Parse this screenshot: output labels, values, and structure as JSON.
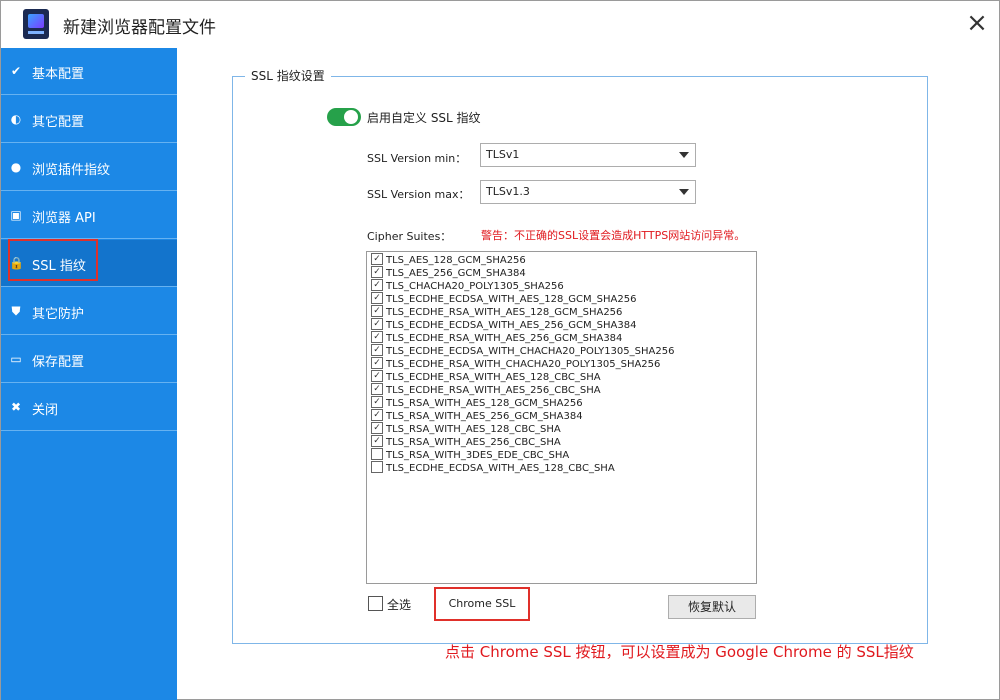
{
  "window": {
    "title": "新建浏览器配置文件",
    "close_icon": "×"
  },
  "sidebar": {
    "items": [
      {
        "label": "基本配置",
        "icon": "✔"
      },
      {
        "label": "其它配置",
        "icon": "◐"
      },
      {
        "label": "浏览插件指纹",
        "icon": "●"
      },
      {
        "label": "浏览器 API",
        "icon": "▣"
      },
      {
        "label": "SSL 指纹",
        "icon": "🔒"
      },
      {
        "label": "其它防护",
        "icon": "⛊"
      },
      {
        "label": "保存配置",
        "icon": "▭"
      },
      {
        "label": "关闭",
        "icon": "✖"
      }
    ],
    "active_index": 4
  },
  "ssl": {
    "group_title": "SSL 指纹设置",
    "toggle_label": "启用自定义 SSL 指纹",
    "toggle_on": true,
    "version_min_label": "SSL Version min：",
    "version_min_value": "TLSv1",
    "version_max_label": "SSL Version max：",
    "version_max_value": "TLSv1.3",
    "cipher_label": "Cipher Suites：",
    "warning": "警告：不正确的SSL设置会造成HTTPS网站访问异常。",
    "ciphers": [
      {
        "name": "TLS_AES_128_GCM_SHA256",
        "checked": true
      },
      {
        "name": "TLS_AES_256_GCM_SHA384",
        "checked": true
      },
      {
        "name": "TLS_CHACHA20_POLY1305_SHA256",
        "checked": true
      },
      {
        "name": "TLS_ECDHE_ECDSA_WITH_AES_128_GCM_SHA256",
        "checked": true
      },
      {
        "name": "TLS_ECDHE_RSA_WITH_AES_128_GCM_SHA256",
        "checked": true
      },
      {
        "name": "TLS_ECDHE_ECDSA_WITH_AES_256_GCM_SHA384",
        "checked": true
      },
      {
        "name": "TLS_ECDHE_RSA_WITH_AES_256_GCM_SHA384",
        "checked": true
      },
      {
        "name": "TLS_ECDHE_ECDSA_WITH_CHACHA20_POLY1305_SHA256",
        "checked": true
      },
      {
        "name": "TLS_ECDHE_RSA_WITH_CHACHA20_POLY1305_SHA256",
        "checked": true
      },
      {
        "name": "TLS_ECDHE_RSA_WITH_AES_128_CBC_SHA",
        "checked": true
      },
      {
        "name": "TLS_ECDHE_RSA_WITH_AES_256_CBC_SHA",
        "checked": true
      },
      {
        "name": "TLS_RSA_WITH_AES_128_GCM_SHA256",
        "checked": true
      },
      {
        "name": "TLS_RSA_WITH_AES_256_GCM_SHA384",
        "checked": true
      },
      {
        "name": "TLS_RSA_WITH_AES_128_CBC_SHA",
        "checked": true
      },
      {
        "name": "TLS_RSA_WITH_AES_256_CBC_SHA",
        "checked": true
      },
      {
        "name": "TLS_RSA_WITH_3DES_EDE_CBC_SHA",
        "checked": false
      },
      {
        "name": "TLS_ECDHE_ECDSA_WITH_AES_128_CBC_SHA",
        "checked": false
      }
    ],
    "select_all_label": "全选",
    "select_all_checked": false,
    "chrome_ssl_button": "Chrome SSL",
    "restore_default_button": "恢复默认"
  },
  "annotation": "点击 Chrome SSL 按钮，可以设置成为 Google Chrome 的 SSL指纹",
  "colors": {
    "sidebar": "#1c88e6",
    "toggle_on": "#26a14a",
    "warning": "#e0191e",
    "highlight": "#e0302a"
  }
}
